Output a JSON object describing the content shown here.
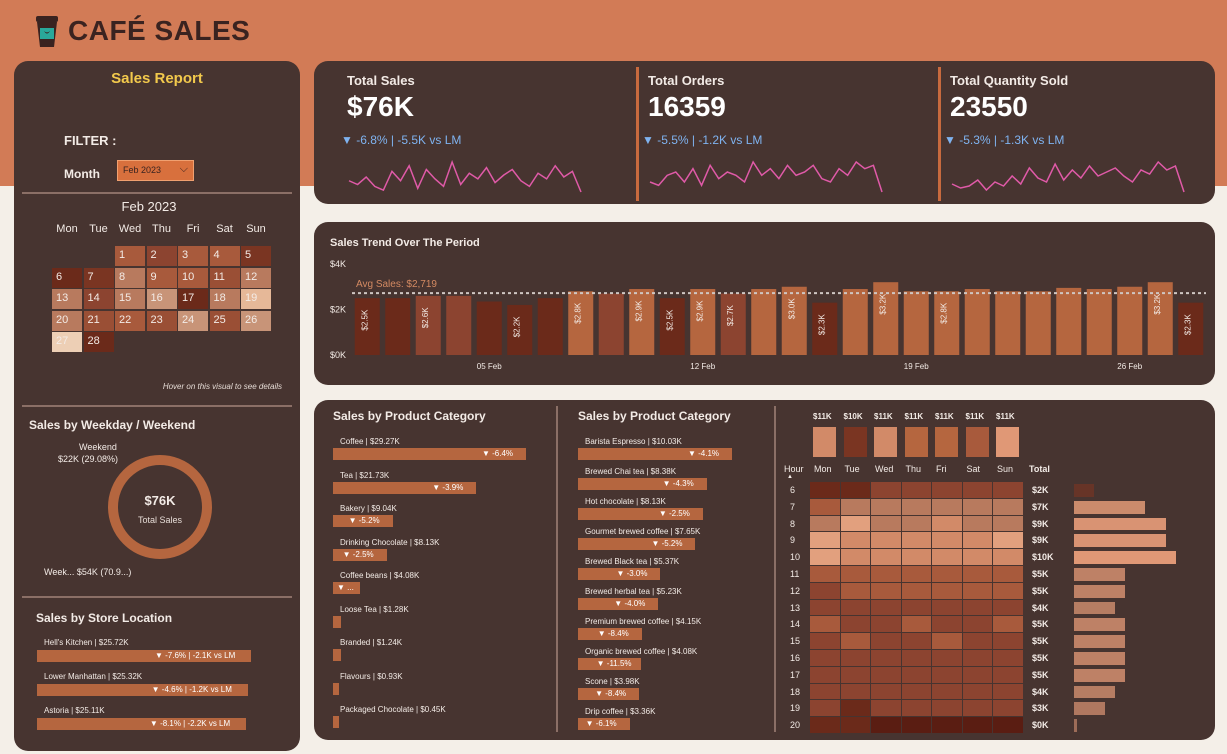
{
  "header": {
    "title": "CAFÉ SALES",
    "icon": "coffee-cup-icon"
  },
  "left": {
    "title": "Sales Report",
    "filter_label": "FILTER :",
    "month_label": "Month",
    "month_value": "Feb 2023",
    "calendar": {
      "title": "Feb 2023",
      "dow": [
        "Mon",
        "Tue",
        "Wed",
        "Thu",
        "Fri",
        "Sat",
        "Sun"
      ],
      "days": [
        {
          "d": "1",
          "col": 2,
          "row": 0,
          "c": "#a85a3c"
        },
        {
          "d": "2",
          "col": 3,
          "row": 0,
          "c": "#8c4430"
        },
        {
          "d": "3",
          "col": 4,
          "row": 0,
          "c": "#a85a3c"
        },
        {
          "d": "4",
          "col": 5,
          "row": 0,
          "c": "#a85a3c"
        },
        {
          "d": "5",
          "col": 6,
          "row": 0,
          "c": "#7a3522"
        },
        {
          "d": "6",
          "col": 0,
          "row": 1,
          "c": "#6b2a1a"
        },
        {
          "d": "7",
          "col": 1,
          "row": 1,
          "c": "#7a3522"
        },
        {
          "d": "8",
          "col": 2,
          "row": 1,
          "c": "#b87a5e"
        },
        {
          "d": "9",
          "col": 3,
          "row": 1,
          "c": "#a85a3c"
        },
        {
          "d": "10",
          "col": 4,
          "row": 1,
          "c": "#a85a3c"
        },
        {
          "d": "11",
          "col": 5,
          "row": 1,
          "c": "#9a4f35"
        },
        {
          "d": "12",
          "col": 6,
          "row": 1,
          "c": "#b87a5e"
        },
        {
          "d": "13",
          "col": 0,
          "row": 2,
          "c": "#b87a5e"
        },
        {
          "d": "14",
          "col": 1,
          "row": 2,
          "c": "#8c4430"
        },
        {
          "d": "15",
          "col": 2,
          "row": 2,
          "c": "#b87a5e"
        },
        {
          "d": "16",
          "col": 3,
          "row": 2,
          "c": "#c89478"
        },
        {
          "d": "17",
          "col": 4,
          "row": 2,
          "c": "#6b2a1a"
        },
        {
          "d": "18",
          "col": 5,
          "row": 2,
          "c": "#b87a5e"
        },
        {
          "d": "19",
          "col": 6,
          "row": 2,
          "c": "#e6b898"
        },
        {
          "d": "20",
          "col": 0,
          "row": 3,
          "c": "#b87a5e"
        },
        {
          "d": "21",
          "col": 1,
          "row": 3,
          "c": "#9a4f35"
        },
        {
          "d": "22",
          "col": 2,
          "row": 3,
          "c": "#a85a3c"
        },
        {
          "d": "23",
          "col": 3,
          "row": 3,
          "c": "#9a4f35"
        },
        {
          "d": "24",
          "col": 4,
          "row": 3,
          "c": "#c89478"
        },
        {
          "d": "25",
          "col": 5,
          "row": 3,
          "c": "#9a4f35"
        },
        {
          "d": "26",
          "col": 6,
          "row": 3,
          "c": "#c89478"
        },
        {
          "d": "27",
          "col": 0,
          "row": 4,
          "c": "#edcfb5"
        },
        {
          "d": "28",
          "col": 1,
          "row": 4,
          "c": "#6b2a1a"
        }
      ],
      "note": "Hover on this visual to see details"
    },
    "weekday": {
      "title": "Sales by Weekday / Weekend",
      "weekend_label": "Weekend",
      "weekend_value": "$22K (29.08%)",
      "weekday_label": "Week... $54K (70.9...)",
      "center_value": "$76K",
      "center_label": "Total Sales",
      "weekend_fraction": 0.2908,
      "colors": {
        "weekday": "#b5663f",
        "weekend": "#7a3522"
      }
    },
    "stores": {
      "title": "Sales by Store Location",
      "items": [
        {
          "name": "Hell's Kitchen | $25.72K",
          "delta": "▼ -7.6% | -2.1K vs LM",
          "value": 25.72
        },
        {
          "name": "Lower Manhattan | $25.32K",
          "delta": "▼ -4.6% | -1.2K vs LM",
          "value": 25.32
        },
        {
          "name": "Astoria | $25.11K",
          "delta": "▼ -8.1% | -2.2K vs LM",
          "value": 25.11
        }
      ]
    }
  },
  "kpis": [
    {
      "name": "Total Sales",
      "value": "$76K",
      "delta": "▼ -6.8% | -5.5K vs LM",
      "spark": [
        30,
        28,
        32,
        27,
        25,
        35,
        30,
        38,
        26,
        36,
        31,
        27,
        40,
        28,
        34,
        31,
        37,
        29,
        33,
        36,
        30,
        27,
        34,
        31,
        38,
        32,
        35,
        24
      ]
    },
    {
      "name": "Total Orders",
      "value": "16359",
      "delta": "▼ -5.5% | -1.2K vs LM",
      "spark": [
        28,
        27,
        30,
        31,
        28,
        32,
        27,
        33,
        29,
        31,
        30,
        28,
        34,
        30,
        32,
        29,
        33,
        30,
        31,
        33,
        29,
        28,
        32,
        30,
        34,
        32,
        33,
        25
      ]
    },
    {
      "name": "Total Quantity Sold",
      "value": "23550",
      "delta": "▼ -5.3% | -1.3K vs LM",
      "spark": [
        26,
        24,
        25,
        28,
        23,
        27,
        25,
        30,
        26,
        34,
        29,
        27,
        36,
        28,
        33,
        29,
        35,
        30,
        32,
        34,
        30,
        27,
        33,
        31,
        37,
        33,
        35,
        22
      ]
    }
  ],
  "spark_color": "#e05aa8",
  "trend": {
    "title": "Sales Trend Over The Period",
    "avg_label": "Avg Sales: $2,719",
    "y_ticks": [
      "$4K",
      "$2K",
      "$0K"
    ],
    "x_ticks": [
      "05 Feb",
      "12 Feb",
      "19 Feb",
      "26 Feb"
    ]
  },
  "chart_data": {
    "type": "bar",
    "title": "Sales Trend Over The Period",
    "categories": [
      "1",
      "2",
      "3",
      "4",
      "5",
      "6",
      "7",
      "8",
      "9",
      "10",
      "11",
      "12",
      "13",
      "14",
      "15",
      "16",
      "17",
      "18",
      "19",
      "20",
      "21",
      "22",
      "23",
      "24",
      "25",
      "26",
      "27",
      "28"
    ],
    "values": [
      2.5,
      2.5,
      2.6,
      2.6,
      2.35,
      2.2,
      2.5,
      2.8,
      2.7,
      2.9,
      2.5,
      2.9,
      2.7,
      2.9,
      3.0,
      2.3,
      2.9,
      3.2,
      2.8,
      2.8,
      2.9,
      2.8,
      2.8,
      2.95,
      2.9,
      3.0,
      3.2,
      2.3
    ],
    "labels": [
      "$2.5K",
      "",
      "$2.6K",
      "",
      "",
      "$2.2K",
      "",
      "$2.8K",
      "",
      "$2.9K",
      "$2.5K",
      "$2.9K",
      "$2.7K",
      "",
      "$3.0K",
      "$2.3K",
      "",
      "$3.2K",
      "",
      "$2.8K",
      "",
      "",
      "",
      "",
      "",
      "",
      "$3.2K",
      "$2.3K"
    ],
    "avg": 2.719,
    "ylim": [
      0,
      4
    ],
    "y_unit": "K$",
    "xlabel": "",
    "ylabel": ""
  },
  "cat1": {
    "title": "Sales by Product Category",
    "items": [
      {
        "label": "Coffee | $29.27K",
        "value": 29.27,
        "delta": "▼ -6.4%"
      },
      {
        "label": "Tea | $21.73K",
        "value": 21.73,
        "delta": "▼ -3.9%"
      },
      {
        "label": "Bakery | $9.04K",
        "value": 9.04,
        "delta": "▼ -5.2%"
      },
      {
        "label": "Drinking Chocolate | $8.13K",
        "value": 8.13,
        "delta": "▼ -2.5%"
      },
      {
        "label": "Coffee beans | $4.08K",
        "value": 4.08,
        "delta": "▼ ..."
      },
      {
        "label": "Loose Tea | $1.28K",
        "value": 1.28,
        "delta": ""
      },
      {
        "label": "Branded | $1.24K",
        "value": 1.24,
        "delta": ""
      },
      {
        "label": "Flavours | $0.93K",
        "value": 0.93,
        "delta": ""
      },
      {
        "label": "Packaged Chocolate | $0.45K",
        "value": 0.45,
        "delta": ""
      }
    ]
  },
  "cat2": {
    "title": "Sales by Product Category",
    "items": [
      {
        "label": "Barista Espresso | $10.03K",
        "value": 10.03,
        "delta": "▼ -4.1%"
      },
      {
        "label": "Brewed Chai tea | $8.38K",
        "value": 8.38,
        "delta": "▼ -4.3%"
      },
      {
        "label": "Hot chocolate | $8.13K",
        "value": 8.13,
        "delta": "▼ -2.5%"
      },
      {
        "label": "Gourmet brewed coffee | $7.65K",
        "value": 7.65,
        "delta": "▼ -5.2%"
      },
      {
        "label": "Brewed Black tea | $5.37K",
        "value": 5.37,
        "delta": "▼ -3.0%"
      },
      {
        "label": "Brewed herbal tea | $5.23K",
        "value": 5.23,
        "delta": "▼ -4.0%"
      },
      {
        "label": "Premium brewed coffee | $4.15K",
        "value": 4.15,
        "delta": "▼ -8.4%"
      },
      {
        "label": "Organic brewed coffee | $4.08K",
        "value": 4.08,
        "delta": "▼ -11.5%"
      },
      {
        "label": "Scone | $3.98K",
        "value": 3.98,
        "delta": "▼ -8.4%"
      },
      {
        "label": "Drip coffee | $3.36K",
        "value": 3.36,
        "delta": "▼ -6.1%"
      }
    ]
  },
  "heatmap": {
    "days": [
      "Mon",
      "Tue",
      "Wed",
      "Thu",
      "Fri",
      "Sat",
      "Sun"
    ],
    "day_totals": [
      "$11K",
      "$10K",
      "$11K",
      "$11K",
      "$11K",
      "$11K",
      "$11K"
    ],
    "day_colors": [
      "#d28a68",
      "#7a3522",
      "#d28a68",
      "#b5663f",
      "#b5663f",
      "#a85a3c",
      "#e09876"
    ],
    "hour_label": "Hour",
    "total_label": "Total",
    "hours": [
      "6",
      "7",
      "8",
      "9",
      "10",
      "11",
      "12",
      "13",
      "14",
      "15",
      "16",
      "17",
      "18",
      "19",
      "20"
    ],
    "hour_totals": [
      "$2K",
      "$7K",
      "$9K",
      "$9K",
      "$10K",
      "$5K",
      "$5K",
      "$4K",
      "$5K",
      "$5K",
      "$5K",
      "$5K",
      "$4K",
      "$3K",
      "$0K"
    ],
    "hour_values": [
      2,
      7,
      9,
      9,
      10,
      5,
      5,
      4,
      5,
      5,
      5,
      5,
      4,
      3,
      0.3
    ],
    "levels": [
      [
        1,
        1,
        2,
        2,
        2,
        2,
        2
      ],
      [
        3,
        4,
        4,
        4,
        4,
        4,
        4
      ],
      [
        4,
        6,
        4,
        4,
        5,
        4,
        4
      ],
      [
        6,
        5,
        5,
        5,
        5,
        5,
        6
      ],
      [
        6,
        5,
        5,
        5,
        5,
        5,
        5
      ],
      [
        3,
        3,
        3,
        3,
        3,
        3,
        3
      ],
      [
        2,
        3,
        3,
        3,
        3,
        3,
        3
      ],
      [
        2,
        2,
        2,
        2,
        2,
        2,
        2
      ],
      [
        3,
        2,
        2,
        3,
        2,
        2,
        3
      ],
      [
        2,
        3,
        2,
        2,
        3,
        2,
        2
      ],
      [
        2,
        2,
        2,
        2,
        2,
        2,
        2
      ],
      [
        2,
        2,
        2,
        2,
        2,
        2,
        2
      ],
      [
        2,
        2,
        2,
        2,
        2,
        2,
        2
      ],
      [
        2,
        1,
        2,
        2,
        2,
        2,
        2
      ],
      [
        1,
        1,
        0,
        0,
        0,
        0,
        0
      ]
    ],
    "palette": [
      "#5a1d12",
      "#6b2a1a",
      "#8c4430",
      "#a85a3c",
      "#b87a5e",
      "#d28a68",
      "#e2a07e"
    ]
  }
}
